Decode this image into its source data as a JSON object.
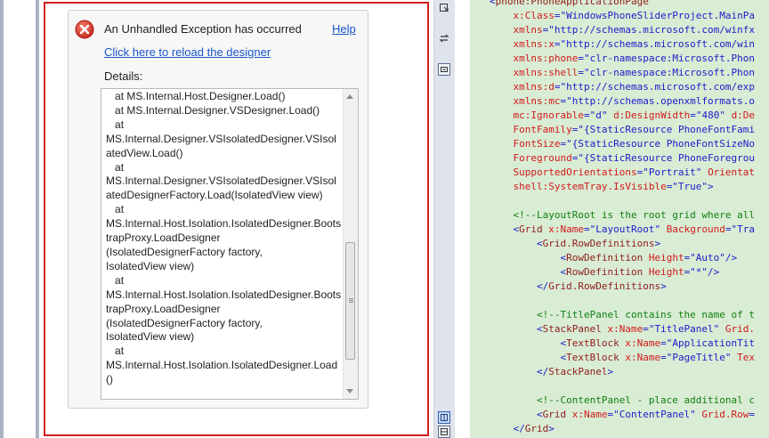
{
  "dialog": {
    "title": "An Unhandled Exception has occurred",
    "help_label": "Help",
    "reload_label": "Click here to reload the designer",
    "details_label": "Details:",
    "details_text": "   at MS.Internal.Host.Designer.Load()\n   at MS.Internal.Designer.VSDesigner.Load()\n   at\nMS.Internal.Designer.VSIsolatedDesigner.VSIsolatedView.Load()\n   at\nMS.Internal.Designer.VSIsolatedDesigner.VSIsolatedDesignerFactory.Load(IsolatedView view)\n   at\nMS.Internal.Host.Isolation.IsolatedDesigner.BootstrapProxy.LoadDesigner\n(IsolatedDesignerFactory factory,\nIsolatedView view)\n   at\nMS.Internal.Host.Isolation.IsolatedDesigner.BootstrapProxy.LoadDesigner\n(IsolatedDesignerFactory factory,\nIsolatedView view)\n   at\nMS.Internal.Host.Isolation.IsolatedDesigner.Load()"
  },
  "splitter": {
    "top_icon": "pane-down-icon",
    "swap_icon": "swap-panes-icon",
    "collapse_icon": "collapse-pane-icon",
    "split_icon": "split-vertical-icon",
    "horizontal_icon": "split-horizontal-icon"
  },
  "code": {
    "lines": [
      {
        "indent": "",
        "parts": [
          {
            "t": "<",
            "c": "c-val"
          },
          {
            "t": "phone:PhoneApplicationPage",
            "c": "c-tag"
          }
        ]
      },
      {
        "indent": "    ",
        "parts": [
          {
            "t": "x:Class",
            "c": "c-attr"
          },
          {
            "t": "=\"WindowsPhoneSliderProject.MainPa",
            "c": "c-val"
          }
        ]
      },
      {
        "indent": "    ",
        "parts": [
          {
            "t": "xmlns",
            "c": "c-attr"
          },
          {
            "t": "=\"http://schemas.microsoft.com/winfx",
            "c": "c-val"
          }
        ]
      },
      {
        "indent": "    ",
        "parts": [
          {
            "t": "xmlns:x",
            "c": "c-attr"
          },
          {
            "t": "=\"http://schemas.microsoft.com/win",
            "c": "c-val"
          }
        ]
      },
      {
        "indent": "    ",
        "parts": [
          {
            "t": "xmlns:phone",
            "c": "c-attr"
          },
          {
            "t": "=\"clr-namespace:Microsoft.Phon",
            "c": "c-val"
          }
        ]
      },
      {
        "indent": "    ",
        "parts": [
          {
            "t": "xmlns:shell",
            "c": "c-attr"
          },
          {
            "t": "=\"clr-namespace:Microsoft.Phon",
            "c": "c-val"
          }
        ]
      },
      {
        "indent": "    ",
        "parts": [
          {
            "t": "xmlns:d",
            "c": "c-attr"
          },
          {
            "t": "=\"http://schemas.microsoft.com/exp",
            "c": "c-val"
          }
        ]
      },
      {
        "indent": "    ",
        "parts": [
          {
            "t": "xmlns:mc",
            "c": "c-attr"
          },
          {
            "t": "=\"http://schemas.openxmlformats.o",
            "c": "c-val"
          }
        ]
      },
      {
        "indent": "    ",
        "parts": [
          {
            "t": "mc:Ignorable",
            "c": "c-attr"
          },
          {
            "t": "=\"d\" ",
            "c": "c-val"
          },
          {
            "t": "d:DesignWidth",
            "c": "c-attr"
          },
          {
            "t": "=\"480\" ",
            "c": "c-val"
          },
          {
            "t": "d:De",
            "c": "c-attr"
          }
        ]
      },
      {
        "indent": "    ",
        "parts": [
          {
            "t": "FontFamily",
            "c": "c-attr"
          },
          {
            "t": "=\"{StaticResource PhoneFontFami",
            "c": "c-val"
          }
        ]
      },
      {
        "indent": "    ",
        "parts": [
          {
            "t": "FontSize",
            "c": "c-attr"
          },
          {
            "t": "=\"{StaticResource PhoneFontSizeNo",
            "c": "c-val"
          }
        ]
      },
      {
        "indent": "    ",
        "parts": [
          {
            "t": "Foreground",
            "c": "c-attr"
          },
          {
            "t": "=\"{StaticResource PhoneForegrou",
            "c": "c-val"
          }
        ]
      },
      {
        "indent": "    ",
        "parts": [
          {
            "t": "SupportedOrientations",
            "c": "c-attr"
          },
          {
            "t": "=\"Portrait\" ",
            "c": "c-val"
          },
          {
            "t": "Orientat",
            "c": "c-attr"
          }
        ]
      },
      {
        "indent": "    ",
        "parts": [
          {
            "t": "shell:SystemTray.IsVisible",
            "c": "c-attr"
          },
          {
            "t": "=\"True\">",
            "c": "c-val"
          }
        ]
      },
      {
        "indent": "",
        "parts": []
      },
      {
        "indent": "    ",
        "parts": [
          {
            "t": "<!--LayoutRoot is the root grid where all",
            "c": "c-cmt"
          }
        ]
      },
      {
        "indent": "    ",
        "parts": [
          {
            "t": "<",
            "c": "c-val"
          },
          {
            "t": "Grid",
            "c": "c-tag"
          },
          {
            "t": " x:Name",
            "c": "c-attr"
          },
          {
            "t": "=\"LayoutRoot\" ",
            "c": "c-val"
          },
          {
            "t": "Background",
            "c": "c-attr"
          },
          {
            "t": "=\"Tra",
            "c": "c-val"
          }
        ]
      },
      {
        "indent": "        ",
        "parts": [
          {
            "t": "<",
            "c": "c-val"
          },
          {
            "t": "Grid.RowDefinitions",
            "c": "c-tag"
          },
          {
            "t": ">",
            "c": "c-val"
          }
        ]
      },
      {
        "indent": "            ",
        "parts": [
          {
            "t": "<",
            "c": "c-val"
          },
          {
            "t": "RowDefinition",
            "c": "c-tag"
          },
          {
            "t": " Height",
            "c": "c-attr"
          },
          {
            "t": "=\"Auto\"/>",
            "c": "c-val"
          }
        ]
      },
      {
        "indent": "            ",
        "parts": [
          {
            "t": "<",
            "c": "c-val"
          },
          {
            "t": "RowDefinition",
            "c": "c-tag"
          },
          {
            "t": " Height",
            "c": "c-attr"
          },
          {
            "t": "=\"*\"/>",
            "c": "c-val"
          }
        ]
      },
      {
        "indent": "        ",
        "parts": [
          {
            "t": "</",
            "c": "c-val"
          },
          {
            "t": "Grid.RowDefinitions",
            "c": "c-tag"
          },
          {
            "t": ">",
            "c": "c-val"
          }
        ]
      },
      {
        "indent": "",
        "parts": []
      },
      {
        "indent": "        ",
        "parts": [
          {
            "t": "<!--TitlePanel contains the name of t",
            "c": "c-cmt"
          }
        ]
      },
      {
        "indent": "        ",
        "parts": [
          {
            "t": "<",
            "c": "c-val"
          },
          {
            "t": "StackPanel",
            "c": "c-tag"
          },
          {
            "t": " x:Name",
            "c": "c-attr"
          },
          {
            "t": "=\"TitlePanel\" ",
            "c": "c-val"
          },
          {
            "t": "Grid.",
            "c": "c-attr"
          }
        ]
      },
      {
        "indent": "            ",
        "parts": [
          {
            "t": "<",
            "c": "c-val"
          },
          {
            "t": "TextBlock",
            "c": "c-tag"
          },
          {
            "t": " x:Name",
            "c": "c-attr"
          },
          {
            "t": "=\"ApplicationTit",
            "c": "c-val"
          }
        ]
      },
      {
        "indent": "            ",
        "parts": [
          {
            "t": "<",
            "c": "c-val"
          },
          {
            "t": "TextBlock",
            "c": "c-tag"
          },
          {
            "t": " x:Name",
            "c": "c-attr"
          },
          {
            "t": "=\"PageTitle\" ",
            "c": "c-val"
          },
          {
            "t": "Tex",
            "c": "c-attr"
          }
        ]
      },
      {
        "indent": "        ",
        "parts": [
          {
            "t": "</",
            "c": "c-val"
          },
          {
            "t": "StackPanel",
            "c": "c-tag"
          },
          {
            "t": ">",
            "c": "c-val"
          }
        ]
      },
      {
        "indent": "",
        "parts": []
      },
      {
        "indent": "        ",
        "parts": [
          {
            "t": "<!--ContentPanel - place additional c",
            "c": "c-cmt"
          }
        ]
      },
      {
        "indent": "        ",
        "parts": [
          {
            "t": "<",
            "c": "c-val"
          },
          {
            "t": "Grid",
            "c": "c-tag"
          },
          {
            "t": " x:Name",
            "c": "c-attr"
          },
          {
            "t": "=\"ContentPanel\" ",
            "c": "c-val"
          },
          {
            "t": "Grid.Row",
            "c": "c-attr"
          },
          {
            "t": "=",
            "c": "c-val"
          }
        ]
      },
      {
        "indent": "    ",
        "parts": [
          {
            "t": "</",
            "c": "c-val"
          },
          {
            "t": "Grid",
            "c": "c-tag"
          },
          {
            "t": ">",
            "c": "c-val"
          }
        ]
      }
    ]
  },
  "colors": {
    "error_red": "#d9392b",
    "link_blue": "#1a55c7",
    "designer_border": "#d21e1e",
    "editor_bg": "#d9ecd4"
  }
}
